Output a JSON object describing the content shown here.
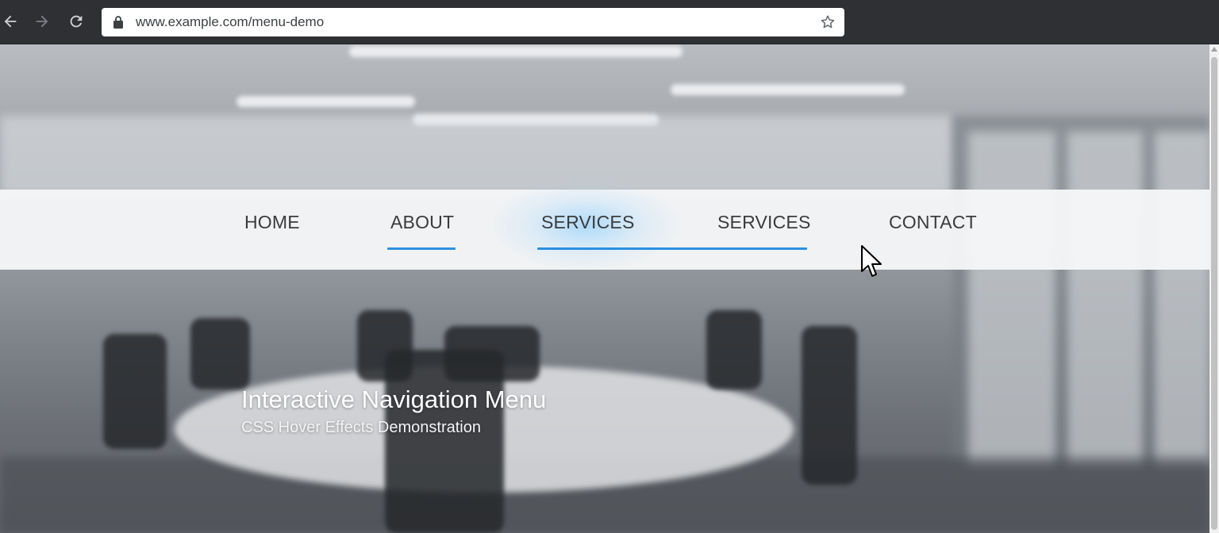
{
  "browser": {
    "url": "www.example.com/menu-demo",
    "icons": {
      "back": "back-arrow-icon",
      "forward": "forward-arrow-icon",
      "reload": "reload-icon",
      "lock": "lock-icon",
      "bookmark": "star-bookmark-icon"
    }
  },
  "menu": {
    "items": [
      {
        "label": "HOME"
      },
      {
        "label": "ABOUT"
      },
      {
        "label": "SERVICES"
      },
      {
        "label": "SERVICES"
      },
      {
        "label": "CONTACT"
      }
    ],
    "accent_color": "#2b8fe0",
    "hover_glow_color": "#78c8ff"
  },
  "hero": {
    "title": "Interactive Navigation Menu",
    "subtitle": "CSS Hover Effects Demonstration"
  }
}
